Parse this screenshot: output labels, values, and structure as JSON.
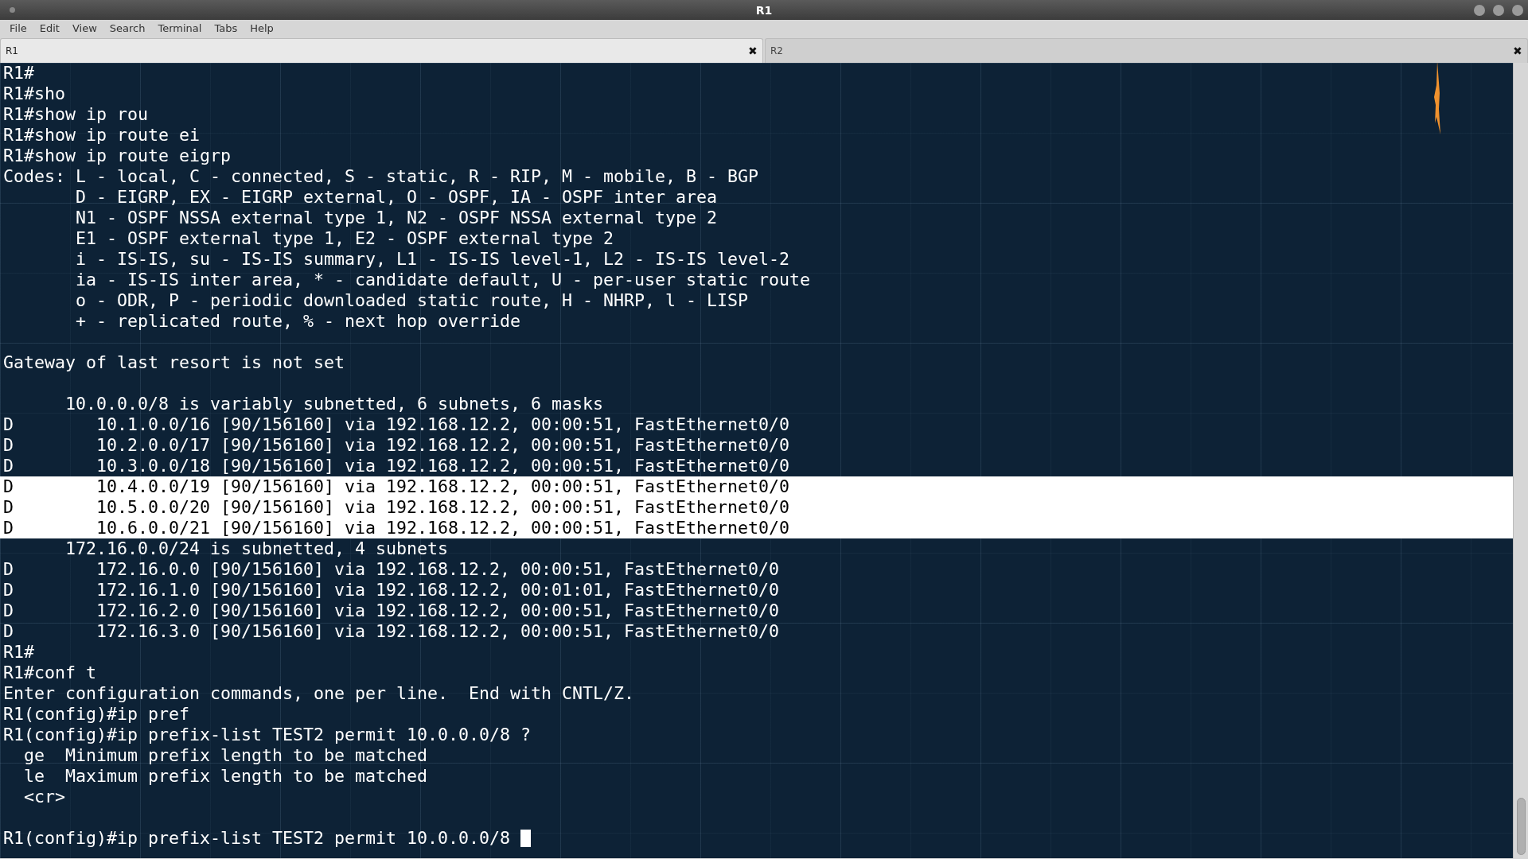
{
  "window": {
    "title": "R1"
  },
  "menu": [
    "File",
    "Edit",
    "View",
    "Search",
    "Terminal",
    "Tabs",
    "Help"
  ],
  "tabs": [
    {
      "label": "R1",
      "selected": true,
      "close": "✖"
    },
    {
      "label": "R2",
      "selected": false,
      "close": "✖"
    }
  ],
  "terminal": {
    "cursor": true,
    "lines": [
      {
        "text": "R1#",
        "selected": false
      },
      {
        "text": "R1#sho",
        "selected": false
      },
      {
        "text": "R1#show ip rou",
        "selected": false
      },
      {
        "text": "R1#show ip route ei",
        "selected": false
      },
      {
        "text": "R1#show ip route eigrp",
        "selected": false
      },
      {
        "text": "Codes: L - local, C - connected, S - static, R - RIP, M - mobile, B - BGP",
        "selected": false
      },
      {
        "text": "       D - EIGRP, EX - EIGRP external, O - OSPF, IA - OSPF inter area",
        "selected": false
      },
      {
        "text": "       N1 - OSPF NSSA external type 1, N2 - OSPF NSSA external type 2",
        "selected": false
      },
      {
        "text": "       E1 - OSPF external type 1, E2 - OSPF external type 2",
        "selected": false
      },
      {
        "text": "       i - IS-IS, su - IS-IS summary, L1 - IS-IS level-1, L2 - IS-IS level-2",
        "selected": false
      },
      {
        "text": "       ia - IS-IS inter area, * - candidate default, U - per-user static route",
        "selected": false
      },
      {
        "text": "       o - ODR, P - periodic downloaded static route, H - NHRP, l - LISP",
        "selected": false
      },
      {
        "text": "       + - replicated route, % - next hop override",
        "selected": false
      },
      {
        "text": "Gateway of last resort is not set",
        "selected": false,
        "blank_before": true
      },
      {
        "text": "      10.0.0.0/8 is variably subnetted, 6 subnets, 6 masks",
        "selected": false,
        "blank_before": true
      },
      {
        "text": "D        10.1.0.0/16 [90/156160] via 192.168.12.2, 00:00:51, FastEthernet0/0",
        "selected": false
      },
      {
        "text": "D        10.2.0.0/17 [90/156160] via 192.168.12.2, 00:00:51, FastEthernet0/0",
        "selected": false
      },
      {
        "text": "D        10.3.0.0/18 [90/156160] via 192.168.12.2, 00:00:51, FastEthernet0/0",
        "selected": false
      },
      {
        "text": "D        10.4.0.0/19 [90/156160] via 192.168.12.2, 00:00:51, FastEthernet0/0",
        "selected": true
      },
      {
        "text": "D        10.5.0.0/20 [90/156160] via 192.168.12.2, 00:00:51, FastEthernet0/0",
        "selected": true
      },
      {
        "text": "D        10.6.0.0/21 [90/156160] via 192.168.12.2, 00:00:51, FastEthernet0/0",
        "selected": true
      },
      {
        "text": "      172.16.0.0/24 is subnetted, 4 subnets",
        "selected": false
      },
      {
        "text": "D        172.16.0.0 [90/156160] via 192.168.12.2, 00:00:51, FastEthernet0/0",
        "selected": false
      },
      {
        "text": "D        172.16.1.0 [90/156160] via 192.168.12.2, 00:01:01, FastEthernet0/0",
        "selected": false
      },
      {
        "text": "D        172.16.2.0 [90/156160] via 192.168.12.2, 00:00:51, FastEthernet0/0",
        "selected": false
      },
      {
        "text": "D        172.16.3.0 [90/156160] via 192.168.12.2, 00:00:51, FastEthernet0/0",
        "selected": false
      },
      {
        "text": "R1#",
        "selected": false
      },
      {
        "text": "R1#conf t",
        "selected": false
      },
      {
        "text": "Enter configuration commands, one per line.  End with CNTL/Z.",
        "selected": false
      },
      {
        "text": "R1(config)#ip pref",
        "selected": false
      },
      {
        "text": "R1(config)#ip prefix-list TEST2 permit 10.0.0.0/8 ?",
        "selected": false
      },
      {
        "text": "  ge  Minimum prefix length to be matched",
        "selected": false
      },
      {
        "text": "  le  Maximum prefix length to be matched",
        "selected": false
      },
      {
        "text": "  <cr>",
        "selected": false
      },
      {
        "text": "R1(config)#ip prefix-list TEST2 permit 10.0.0.0/8 ",
        "selected": false,
        "blank_before": true
      }
    ]
  }
}
